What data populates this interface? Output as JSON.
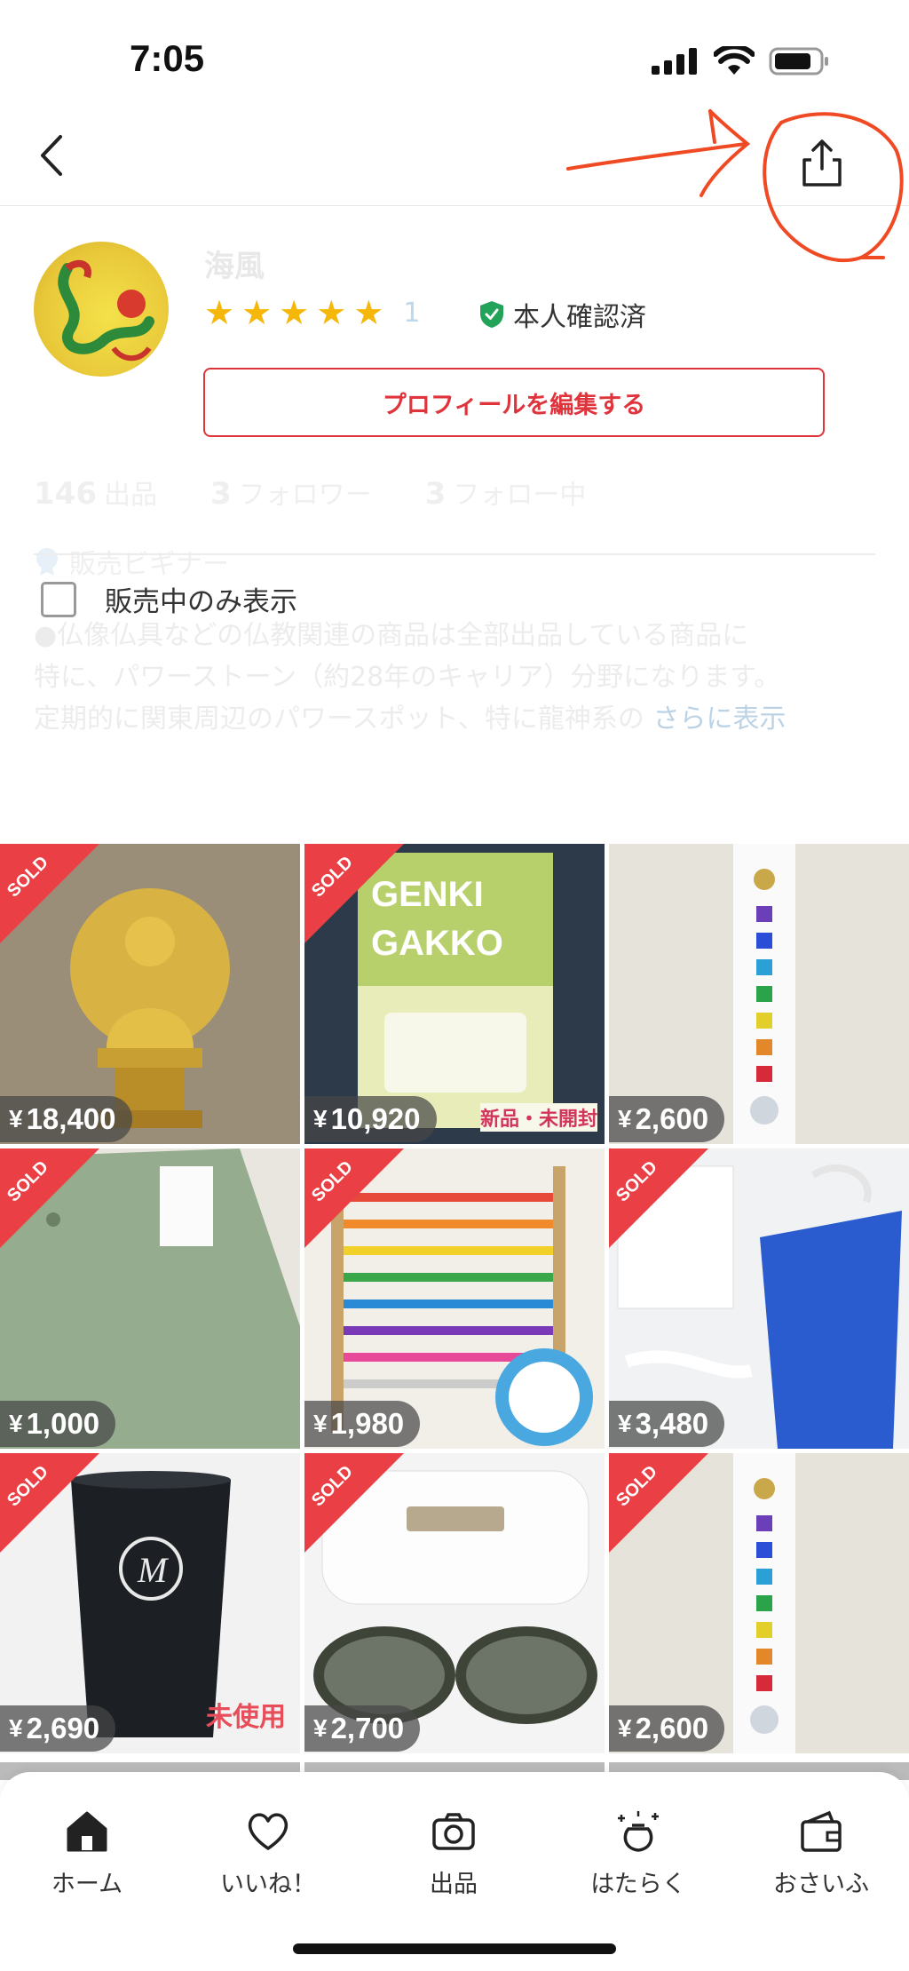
{
  "status_bar": {
    "time": "7:05"
  },
  "profile": {
    "name": "海風",
    "rating_count": "1",
    "verified_label": "本人確認済",
    "edit_button": "プロフィールを編集する",
    "stats": [
      {
        "value": "146",
        "label": "出品"
      },
      {
        "value": "3",
        "label": "フォロワー"
      },
      {
        "value": "3",
        "label": "フォロー中"
      }
    ],
    "badge": "販売ビギナー",
    "bio_line1": "●仏像仏具などの仏教関連の商品は全部出品している商品に",
    "bio_line2": "特に、パワーストーン（約28年のキャリア）分野になります。",
    "bio_line3": "定期的に関東周辺のパワースポット、特に龍神系の",
    "bio_more": "さらに表示"
  },
  "filter": {
    "label": "販売中のみ表示"
  },
  "items": [
    {
      "price": "18,400",
      "sold": true,
      "sold_label": "SOLD",
      "kind": "buddha",
      "note": ""
    },
    {
      "price": "10,920",
      "sold": true,
      "sold_label": "SOLD",
      "kind": "dvd",
      "note": "新品・未開封"
    },
    {
      "price": "2,600",
      "sold": false,
      "sold_label": "",
      "kind": "suncatcher",
      "note": ""
    },
    {
      "price": "1,000",
      "sold": true,
      "sold_label": "SOLD",
      "kind": "pants",
      "note": ""
    },
    {
      "price": "1,980",
      "sold": true,
      "sold_label": "SOLD",
      "kind": "abacus",
      "note": ""
    },
    {
      "price": "3,480",
      "sold": true,
      "sold_label": "SOLD",
      "kind": "bag",
      "note": ""
    },
    {
      "price": "2,690",
      "sold": true,
      "sold_label": "SOLD",
      "kind": "tumbler",
      "note": "未使用"
    },
    {
      "price": "2,700",
      "sold": true,
      "sold_label": "SOLD",
      "kind": "sunglasses",
      "note": ""
    },
    {
      "price": "2,600",
      "sold": true,
      "sold_label": "SOLD",
      "kind": "suncatcher",
      "note": ""
    }
  ],
  "currency": "¥",
  "tabs": [
    {
      "label": "ホーム",
      "icon": "home-icon"
    },
    {
      "label": "いいね！",
      "icon": "heart-icon"
    },
    {
      "label": "出品",
      "icon": "camera-icon"
    },
    {
      "label": "はたらく",
      "icon": "bag-sparkle-icon"
    },
    {
      "label": "おさいふ",
      "icon": "wallet-icon"
    }
  ],
  "colors": {
    "accent": "#e0343d",
    "star": "#f5b70a",
    "annotation": "#f04a24"
  }
}
